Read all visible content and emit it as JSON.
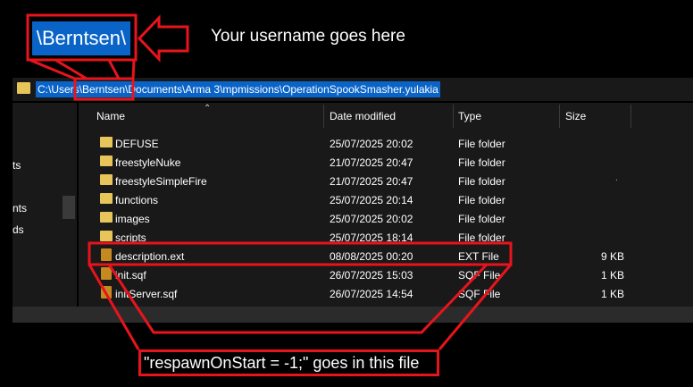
{
  "zoom": {
    "username": "\\Berntsen\\"
  },
  "callout": {
    "text": "Your username goes here"
  },
  "address_bar": {
    "path": "C:\\Users\\Berntsen\\Documents\\Arma 3\\mpmissions\\OperationSpookSmasher.yulakia"
  },
  "sidebar": {
    "items": [
      "ts",
      "nts",
      "ds"
    ]
  },
  "columns": {
    "name": "Name",
    "date": "Date modified",
    "type": "Type",
    "size": "Size"
  },
  "files": [
    {
      "name": "DEFUSE",
      "date": "25/07/2025 20:02",
      "type": "File folder",
      "size": "",
      "kind": "folder"
    },
    {
      "name": "freestyleNuke",
      "date": "21/07/2025 20:47",
      "type": "File folder",
      "size": "",
      "kind": "folder"
    },
    {
      "name": "freestyleSimpleFire",
      "date": "21/07/2025 20:47",
      "type": "File folder",
      "size": "",
      "kind": "folder"
    },
    {
      "name": "functions",
      "date": "25/07/2025 20:14",
      "type": "File folder",
      "size": "",
      "kind": "folder"
    },
    {
      "name": "images",
      "date": "25/07/2025 20:02",
      "type": "File folder",
      "size": "",
      "kind": "folder"
    },
    {
      "name": "scripts",
      "date": "25/07/2025 18:14",
      "type": "File folder",
      "size": "",
      "kind": "folder"
    },
    {
      "name": "description.ext",
      "date": "08/08/2025 00:20",
      "type": "EXT File",
      "size": "9 KB",
      "kind": "file"
    },
    {
      "name": "init.sqf",
      "date": "26/07/2025 15:03",
      "type": "SQF File",
      "size": "1 KB",
      "kind": "file"
    },
    {
      "name": "initServer.sqf",
      "date": "26/07/2025 14:54",
      "type": "SQF File",
      "size": "1 KB",
      "kind": "file"
    }
  ],
  "caption": {
    "text": "\"respawnOnStart = -1;\" goes in this file"
  },
  "colors": {
    "annotation_red": "#e8141c",
    "selection_blue": "#0a64c8",
    "folder_yellow": "#e8c55a"
  }
}
